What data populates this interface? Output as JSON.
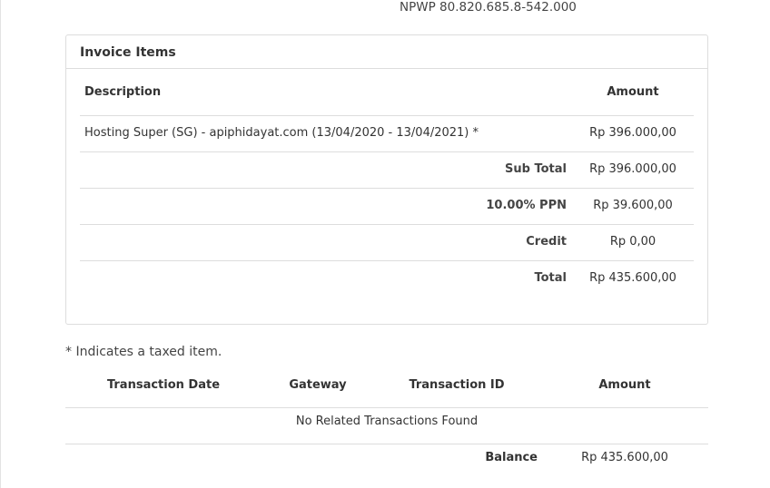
{
  "header": {
    "npwp": "NPWP 80.820.685.8-542.000"
  },
  "invoice_items": {
    "title": "Invoice Items",
    "columns": {
      "description": "Description",
      "amount": "Amount"
    },
    "items": [
      {
        "description": "Hosting Super (SG) - apiphidayat.com (13/04/2020 - 13/04/2021) *",
        "amount": "Rp 396.000,00"
      }
    ],
    "summary": [
      {
        "label": "Sub Total",
        "amount": "Rp 396.000,00"
      },
      {
        "label": "10.00% PPN",
        "amount": "Rp 39.600,00"
      },
      {
        "label": "Credit",
        "amount": "Rp 0,00"
      },
      {
        "label": "Total",
        "amount": "Rp 435.600,00"
      }
    ]
  },
  "taxed_note": "* Indicates a taxed item.",
  "transactions": {
    "columns": {
      "date": "Transaction Date",
      "gateway": "Gateway",
      "transaction_id": "Transaction ID",
      "amount": "Amount"
    },
    "empty_message": "No Related Transactions Found",
    "balance_label": "Balance",
    "balance_amount": "Rp 435.600,00"
  }
}
